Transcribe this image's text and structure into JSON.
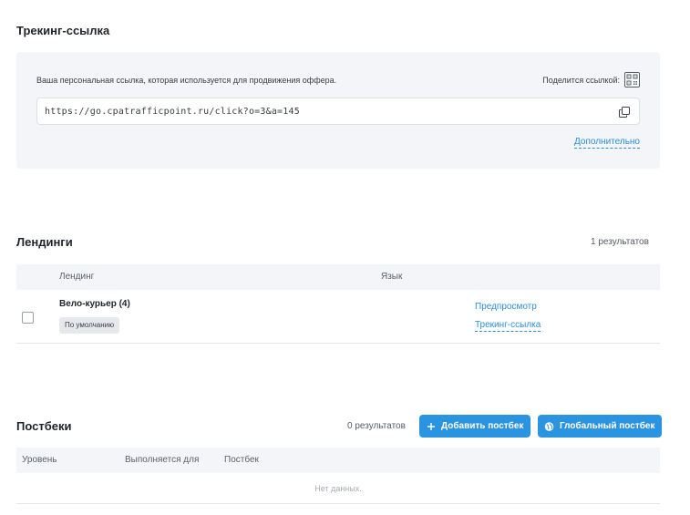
{
  "tracking": {
    "title": "Трекинг-ссылка",
    "description": "Ваша персональная ссылка, которая используется для продвижения оффера.",
    "share_label": "Поделится ссылкой:",
    "url": "https://go.cpatrafficpoint.ru/click?o=3&a=145",
    "more_label": "Дополнительно"
  },
  "landings": {
    "title": "Лендинги",
    "results": "1 результатов",
    "columns": [
      "Лендинг",
      "Язык"
    ],
    "rows": [
      {
        "name": "Вело-курьер (4)",
        "badge": "По умолчанию",
        "preview_label": "Предпросмотр",
        "tracking_label": "Трекинг-ссылка",
        "checked": false
      }
    ]
  },
  "postbacks": {
    "title": "Постбеки",
    "results": "0 результатов",
    "add_label": "Добавить постбек",
    "global_label": "Глобальный постбек",
    "columns": [
      "Уровень",
      "Выполняется для",
      "Постбек"
    ],
    "empty": "Нет данных."
  },
  "colors": {
    "accent": "#2b94e0",
    "link": "#2b8fd6",
    "panel_bg": "#f4f5f8"
  },
  "icons": {
    "qr": "qr-code-icon",
    "copy": "copy-icon",
    "plus": "plus-icon",
    "globe": "globe-icon"
  }
}
